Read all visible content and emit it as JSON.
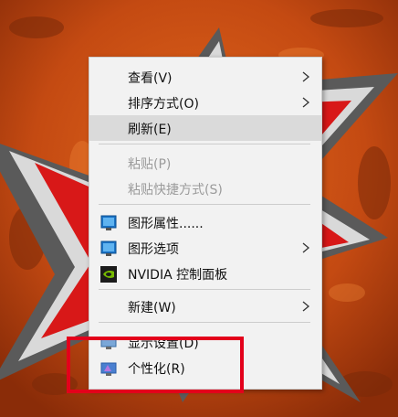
{
  "context_menu": {
    "items": [
      {
        "label": "查看(V)"
      },
      {
        "label": "排序方式(O)"
      },
      {
        "label": "刷新(E)"
      },
      {
        "label": "粘贴(P)"
      },
      {
        "label": "粘贴快捷方式(S)"
      },
      {
        "label": "图形属性......"
      },
      {
        "label": "图形选项"
      },
      {
        "label": "NVIDIA 控制面板"
      },
      {
        "label": "新建(W)"
      },
      {
        "label": "显示设置(D)"
      },
      {
        "label": "个性化(R)"
      }
    ]
  },
  "icons": {
    "graphics_properties": "intel-graphics-icon",
    "graphics_options": "intel-graphics-icon",
    "nvidia": "nvidia-icon",
    "display_settings": "display-icon",
    "personalize": "personalize-icon"
  },
  "colors": {
    "wallpaper_orange": "#c44a12",
    "star_red": "#d81818",
    "menu_background": "#f2f2f2",
    "hover_background": "#dadada",
    "highlight_box": "#e3001b"
  }
}
